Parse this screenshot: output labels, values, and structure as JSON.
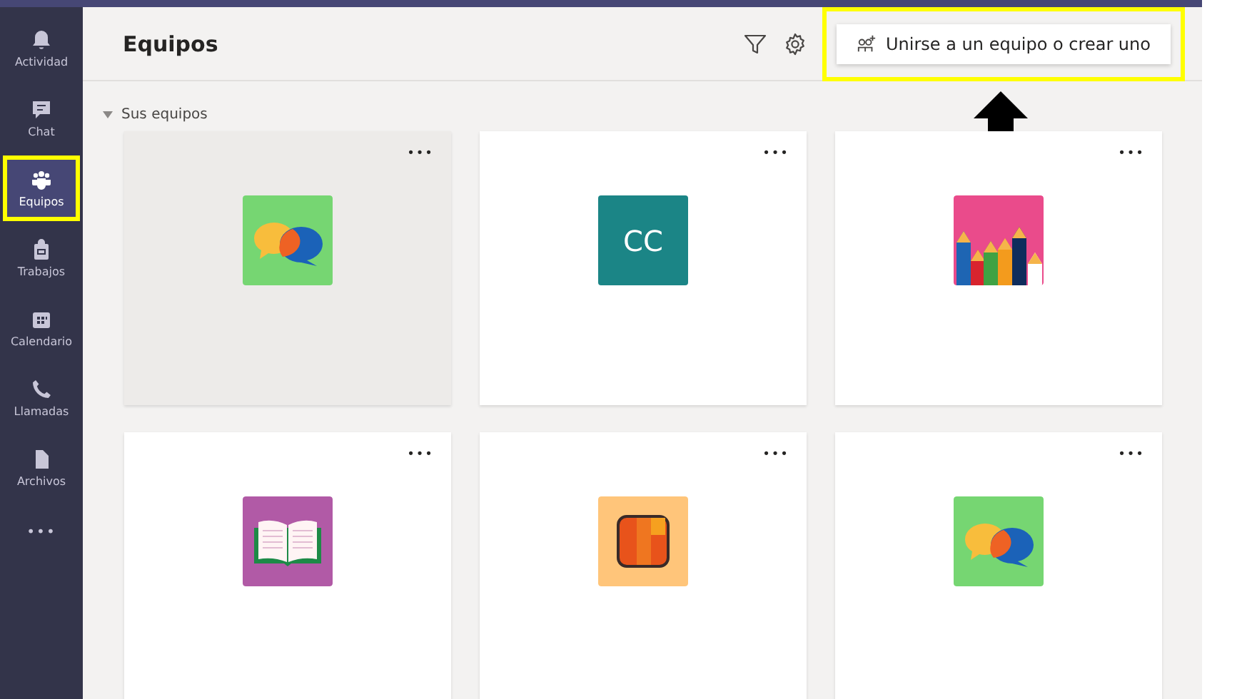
{
  "nav": [
    {
      "label": "Actividad",
      "kind": "bell",
      "selected": false,
      "highlighted": false
    },
    {
      "label": "Chat",
      "kind": "chat",
      "selected": false,
      "highlighted": false
    },
    {
      "label": "Equipos",
      "kind": "teams",
      "selected": true,
      "highlighted": true
    },
    {
      "label": "Trabajos",
      "kind": "bag",
      "selected": false,
      "highlighted": false
    },
    {
      "label": "Calendario",
      "kind": "calendar",
      "selected": false,
      "highlighted": false
    },
    {
      "label": "Llamadas",
      "kind": "phone",
      "selected": false,
      "highlighted": false
    },
    {
      "label": "Archivos",
      "kind": "file",
      "selected": false,
      "highlighted": false
    }
  ],
  "nav_more": "•••",
  "header": {
    "title": "Equipos",
    "join_button": {
      "label": "Unirse a un equipo o crear uno",
      "highlighted": true
    },
    "pointer_arrow": true
  },
  "section": {
    "label": "Sus equipos",
    "expanded": true
  },
  "teams": [
    {
      "kind": "chat",
      "selected": true,
      "more": "•••"
    },
    {
      "kind": "initials",
      "text": "CC",
      "selected": false,
      "more": "•••"
    },
    {
      "kind": "pencils",
      "selected": false,
      "more": "•••"
    },
    {
      "kind": "book",
      "selected": false,
      "more": "•••"
    },
    {
      "kind": "blocks",
      "selected": false,
      "more": "•••"
    },
    {
      "kind": "chat",
      "selected": false,
      "more": "•••"
    }
  ]
}
